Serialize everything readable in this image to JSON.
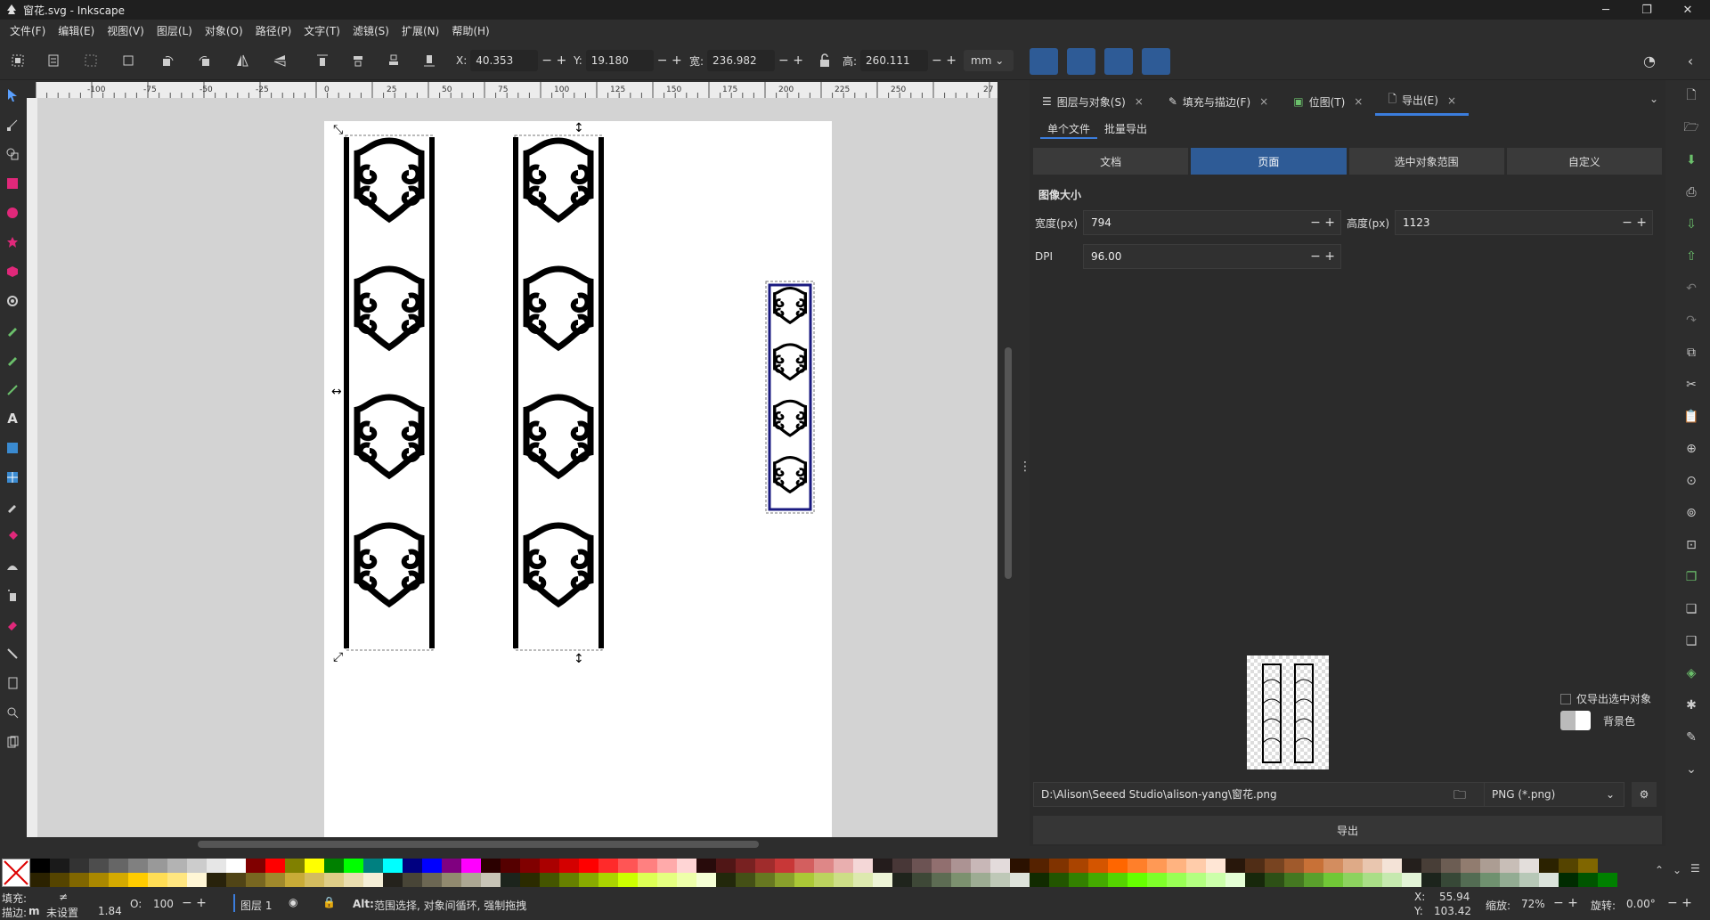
{
  "window": {
    "title": "窗花.svg - Inkscape"
  },
  "menu": [
    "文件(F)",
    "编辑(E)",
    "视图(V)",
    "图层(L)",
    "对象(O)",
    "路径(P)",
    "文字(T)",
    "滤镜(S)",
    "扩展(N)",
    "帮助(H)"
  ],
  "toolbar": {
    "x_label": "X:",
    "x_value": "40.353",
    "y_label": "Y:",
    "y_value": "19.180",
    "w_label": "宽:",
    "w_value": "236.982",
    "h_label": "高:",
    "h_value": "260.111",
    "unit": "mm"
  },
  "ruler": {
    "labels": [
      "-100",
      "-75",
      "-50",
      "-25",
      "0",
      "25",
      "50",
      "75",
      "100",
      "125",
      "150",
      "175",
      "200",
      "225",
      "250",
      "27"
    ]
  },
  "dock": {
    "tabs": [
      {
        "label": "图层与对象(S)",
        "close": "×"
      },
      {
        "label": "填充与描边(F)",
        "close": "×"
      },
      {
        "label": "位图(T)",
        "close": "×"
      },
      {
        "label": "导出(E)",
        "close": "×"
      }
    ],
    "subtabs": [
      "单个文件",
      "批量导出"
    ],
    "modes": [
      "文档",
      "页面",
      "选中对象范围",
      "自定义"
    ],
    "image_size_title": "图像大小",
    "width_label": "宽度(px)",
    "width_value": "794",
    "height_label": "高度(px)",
    "height_value": "1123",
    "dpi_label": "DPI",
    "dpi_value": "96.00",
    "only_selected": "仅导出选中对象",
    "background_color": "背景色",
    "path": "D:\\Alison\\Seeed Studio\\alison-yang\\窗花.png",
    "filetype": "PNG (*.png)",
    "export_button": "导出"
  },
  "status": {
    "fill_label": "填充:",
    "stroke_label": "描边:",
    "stroke_m": "m",
    "stroke_unset": "未设置",
    "stroke_width": "1.84",
    "opacity_label": "O:",
    "opacity_value": "100",
    "layer": "图层 1",
    "hint_key": "Alt:",
    "hint": "范围选择, 对象间循环, 强制拖拽",
    "x_label": "X:",
    "x_value": "55.94",
    "y_label": "Y:",
    "y_value": "103.42",
    "zoom_label": "缩放:",
    "zoom_value": "72%",
    "rotate_label": "旋转:",
    "rotate_value": "0.00°"
  },
  "colors": {
    "accent": "#2e5b96",
    "tab_underline": "#3b7ddd",
    "palette_row1": [
      "#000000",
      "#1a1a1a",
      "#333333",
      "#4d4d4d",
      "#666666",
      "#808080",
      "#999999",
      "#b3b3b3",
      "#cccccc",
      "#e6e6e6",
      "#ffffff",
      "#800000",
      "#ff0000",
      "#808000",
      "#ffff00",
      "#008000",
      "#00ff00",
      "#008080",
      "#00ffff",
      "#000080",
      "#0000ff",
      "#800080",
      "#ff00ff",
      "#2b0000",
      "#550000",
      "#800000",
      "#aa0000",
      "#d40000",
      "#ff0000",
      "#ff2a2a",
      "#ff5555",
      "#ff8080",
      "#ffaaaa",
      "#ffd5d5",
      "#280b0b",
      "#501616",
      "#782121",
      "#a02c2c",
      "#c83737",
      "#d35f5f",
      "#de8787",
      "#e9afaf",
      "#f4d7d7",
      "#241c1c",
      "#483737",
      "#6c5353",
      "#916f6f",
      "#ac9393",
      "#c8b7b7",
      "#e3dbdb",
      "#2b1100",
      "#552200",
      "#803300",
      "#aa4400",
      "#d45500",
      "#ff6600",
      "#ff7f2a",
      "#ff9955",
      "#ffb380",
      "#ffccaa",
      "#ffe6d5",
      "#28170b",
      "#502d16",
      "#784421",
      "#a05a2c",
      "#c87137",
      "#d38d5f",
      "#deaa87",
      "#e9c6af",
      "#f4e3d7",
      "#241f1c",
      "#483e37",
      "#6c5d53",
      "#917c6f",
      "#ac9d93",
      "#c8beb7",
      "#e3dedb",
      "#2b2200",
      "#554400",
      "#806600"
    ],
    "palette_row2": [
      "#2b2200",
      "#554400",
      "#806600",
      "#aa8800",
      "#d4aa00",
      "#ffcc00",
      "#ffdd55",
      "#ffe680",
      "#fff6d5",
      "#28220b",
      "#504416",
      "#786721",
      "#a0892c",
      "#c8ab37",
      "#d3bc5f",
      "#decd87",
      "#e9ddaf",
      "#f4eed7",
      "#24221c",
      "#484537",
      "#6c6753",
      "#918a6f",
      "#aca793",
      "#c8c4b7",
      "#1c241c",
      "#2b2b00",
      "#445500",
      "#668000",
      "#88aa00",
      "#aad400",
      "#ccff00",
      "#ddff55",
      "#e5ff80",
      "#eeffaa",
      "#f6ffd5",
      "#22280b",
      "#445016",
      "#677821",
      "#89a02c",
      "#abc837",
      "#bcd35f",
      "#cdde87",
      "#dde9af",
      "#eef4d7",
      "#1f241c",
      "#3e4837",
      "#5d6c53",
      "#7c916f",
      "#9dac93",
      "#bec8b7",
      "#dee3db",
      "#112b00",
      "#225500",
      "#338000",
      "#44aa00",
      "#55d400",
      "#66ff00",
      "#7fff2a",
      "#99ff55",
      "#b3ff80",
      "#ccffaa",
      "#e5ffd5",
      "#17280b",
      "#2d5016",
      "#447821",
      "#5aa02c",
      "#71c837",
      "#8dd35f",
      "#aade87",
      "#c6e9af",
      "#e3f4d7",
      "#1c241c",
      "#374837",
      "#536c53",
      "#6f916f",
      "#93ac93",
      "#b7c8b7",
      "#dbe3db",
      "#002b00",
      "#005500",
      "#008000"
    ]
  }
}
